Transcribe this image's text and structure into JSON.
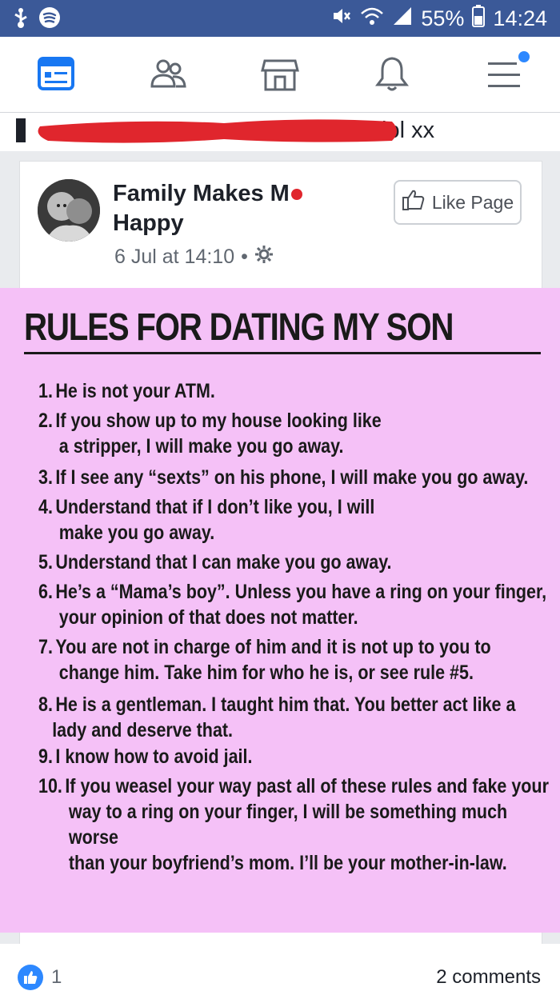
{
  "status_bar": {
    "battery": "55%",
    "time": "14:24",
    "icons": [
      "usb-icon",
      "spotify-icon",
      "mute-icon",
      "wifi-icon",
      "signal-icon",
      "battery-icon"
    ]
  },
  "nav": {
    "tabs": [
      "news-feed-icon",
      "friends-icon",
      "marketplace-icon",
      "notifications-icon",
      "menu-icon"
    ]
  },
  "post_caption": {
    "visible_text": "lol xx"
  },
  "post": {
    "page_name": "Family Makes Me Happy",
    "page_name_line1": "Family Makes M",
    "page_name_line2": "Happy",
    "timestamp": "6 Jul at 14:10",
    "separator": "•",
    "like_page_label": "Like Page"
  },
  "image": {
    "title": "RULES FOR DATING MY SON",
    "background": "#f5c1f7",
    "rules": [
      {
        "num": "1.",
        "lines": [
          "He is not your ATM."
        ]
      },
      {
        "num": "2.",
        "lines": [
          "If you show up to my house looking like",
          "a stripper, I will make you go away."
        ]
      },
      {
        "num": "3.",
        "lines": [
          "If I see any “sexts” on his phone, I will make you go away."
        ]
      },
      {
        "num": "4.",
        "lines": [
          "Understand that if I don’t like you, I will",
          "make you go away."
        ]
      },
      {
        "num": "5.",
        "lines": [
          "Understand that I can make you go away."
        ]
      },
      {
        "num": "6.",
        "lines": [
          "He’s a “Mama’s boy”. Unless you have a ring on your finger,",
          "your opinion of that does not matter."
        ]
      },
      {
        "num": "7.",
        "lines": [
          "You are not in charge of him and it is not up to you to",
          "change him.  Take him for who he is, or see rule #5."
        ]
      },
      {
        "num": "8.",
        "lines": [
          "He is a gentleman. I taught him that. You better act like a",
          "lady and deserve that."
        ]
      },
      {
        "num": "9.",
        "lines": [
          "I know how to avoid jail."
        ]
      },
      {
        "num": "10.",
        "lines": [
          "If you weasel your way past all of these rules and fake your",
          "way to a ring on your finger, I will be something much worse",
          "than your boyfriend’s mom. I’ll be your mother-in-law."
        ]
      }
    ]
  },
  "footer": {
    "like_count": "1",
    "comments": "2 comments"
  },
  "colors": {
    "facebook_blue": "#3b5998",
    "accent_blue": "#2d88ff",
    "redaction_red": "#e0262d"
  }
}
